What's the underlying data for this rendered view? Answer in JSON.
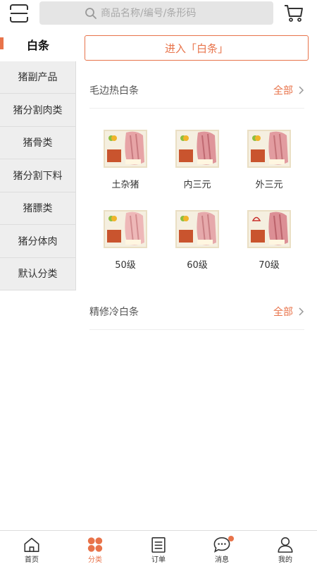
{
  "header": {
    "scan_icon": "scan-icon",
    "search_placeholder": "商品名称/编号/条形码",
    "cart_icon": "cart-icon"
  },
  "sidebar": {
    "items": [
      {
        "label": "白条",
        "active": true
      },
      {
        "label": "猪副产品"
      },
      {
        "label": "猪分割肉类"
      },
      {
        "label": "猪骨类"
      },
      {
        "label": "猪分割下料"
      },
      {
        "label": "猪膘类"
      },
      {
        "label": "猪分体肉"
      },
      {
        "label": "默认分类"
      }
    ]
  },
  "main": {
    "enter_button": "进入「白条」",
    "sections": [
      {
        "title": "毛边热白条",
        "all_label": "全部",
        "products": [
          {
            "label": "土杂猪"
          },
          {
            "label": "内三元"
          },
          {
            "label": "外三元"
          },
          {
            "label": "50级"
          },
          {
            "label": "60级"
          },
          {
            "label": "70级"
          }
        ]
      },
      {
        "title": "精修冷白条",
        "all_label": "全部",
        "products": []
      }
    ]
  },
  "tabbar": {
    "items": [
      {
        "label": "首页",
        "icon": "home-icon"
      },
      {
        "label": "分类",
        "icon": "category-icon",
        "active": true
      },
      {
        "label": "订单",
        "icon": "order-icon"
      },
      {
        "label": "消息",
        "icon": "message-icon",
        "badge": true
      },
      {
        "label": "我的",
        "icon": "profile-icon"
      }
    ]
  },
  "colors": {
    "accent": "#e8734a",
    "sidebar_bg": "#eeeeee",
    "search_bg": "#e5e5e5"
  }
}
